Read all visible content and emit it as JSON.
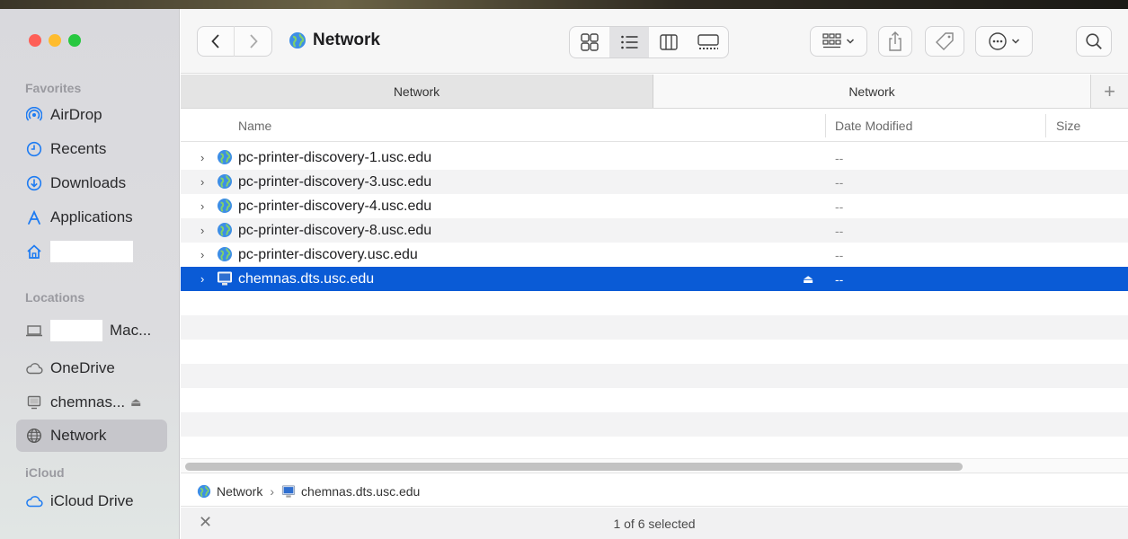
{
  "toolbar": {
    "title": "Network",
    "back_icon": "chevron-left-icon",
    "forward_icon": "chevron-right-icon",
    "view_modes": [
      "icon-view-icon",
      "list-view-icon",
      "column-view-icon",
      "gallery-view-icon"
    ],
    "active_view": "list-view-icon"
  },
  "tabs": [
    {
      "label": "Network"
    },
    {
      "label": "Network"
    }
  ],
  "tab_add_label": "+",
  "sidebar": {
    "favorites_header": "Favorites",
    "favorites": [
      {
        "label": "AirDrop",
        "icon": "airdrop-icon"
      },
      {
        "label": "Recents",
        "icon": "clock-icon"
      },
      {
        "label": "Downloads",
        "icon": "download-icon"
      },
      {
        "label": "Applications",
        "icon": "applications-icon"
      },
      {
        "label": "",
        "icon": "home-icon"
      }
    ],
    "locations_header": "Locations",
    "locations": [
      {
        "label": "Mac...",
        "icon": "laptop-icon"
      },
      {
        "label": "OneDrive",
        "icon": "cloud-icon"
      },
      {
        "label": "chemnas...",
        "icon": "server-icon"
      },
      {
        "label": "Network",
        "icon": "network-icon"
      }
    ],
    "icloud_header": "iCloud",
    "icloud": [
      {
        "label": "iCloud Drive",
        "icon": "cloud-icon"
      }
    ]
  },
  "columns": {
    "name": "Name",
    "date_modified": "Date Modified",
    "size": "Size"
  },
  "rows": [
    {
      "name": "pc-printer-discovery-1.usc.edu",
      "date": "--"
    },
    {
      "name": "pc-printer-discovery-3.usc.edu",
      "date": "--"
    },
    {
      "name": "pc-printer-discovery-4.usc.edu",
      "date": "--"
    },
    {
      "name": "pc-printer-discovery-8.usc.edu",
      "date": "--"
    },
    {
      "name": "pc-printer-discovery.usc.edu",
      "date": "--"
    },
    {
      "name": "chemnas.dts.usc.edu",
      "date": "--"
    }
  ],
  "path": {
    "root": "Network",
    "separator": "›",
    "leaf": "chemnas.dts.usc.edu"
  },
  "status": {
    "text": "1 of 6 selected"
  },
  "colors": {
    "selection": "#0a5bd6",
    "accent_blue": "#1d7bf2"
  }
}
